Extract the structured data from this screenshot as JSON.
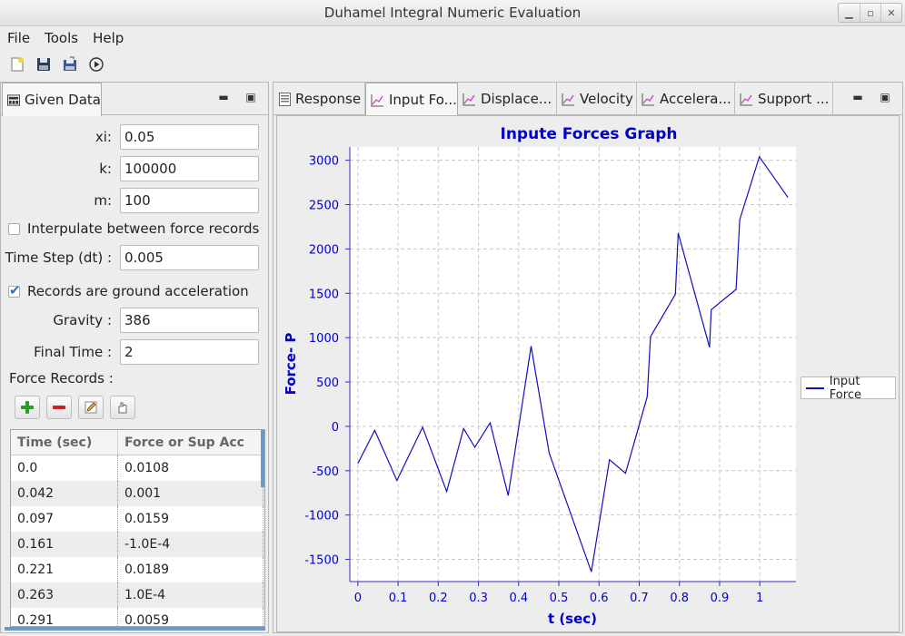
{
  "window": {
    "title": "Duhamel Integral Numeric Evaluation"
  },
  "menu": [
    "File",
    "Tools",
    "Help"
  ],
  "toolbar": [
    "new-file-icon",
    "save-icon",
    "save-as-icon",
    "run-icon"
  ],
  "left_panel": {
    "tab": "Given Data",
    "fields": {
      "xi": {
        "label": "xi:",
        "value": "0.05"
      },
      "k": {
        "label": "k:",
        "value": "100000"
      },
      "m": {
        "label": "m:",
        "value": "100"
      },
      "interpolate": {
        "label": "Interpulate between force records",
        "checked": false
      },
      "dt": {
        "label": "Time Step (dt) :",
        "value": "0.005"
      },
      "ground": {
        "label": "Records are ground acceleration",
        "checked": true
      },
      "gravity": {
        "label": "Gravity :",
        "value": "386"
      },
      "final_time": {
        "label": "Final Time :",
        "value": "2"
      }
    },
    "records_label": "Force Records :",
    "table": {
      "headers": [
        "Time (sec)",
        "Force or Sup Acc"
      ],
      "rows": [
        [
          "0.0",
          "0.0108"
        ],
        [
          "0.042",
          "0.001"
        ],
        [
          "0.097",
          "0.0159"
        ],
        [
          "0.161",
          "-1.0E-4"
        ],
        [
          "0.221",
          "0.0189"
        ],
        [
          "0.263",
          "1.0E-4"
        ],
        [
          "0.291",
          "0.0059"
        ]
      ]
    }
  },
  "right_panel": {
    "tabs": [
      "Response",
      "Input Fo...",
      "Displace...",
      "Velocity",
      "Accelera...",
      "Support ..."
    ],
    "active_tab": 1
  },
  "colors": {
    "series": "#1010c0",
    "title": "#0000cc"
  },
  "chart_data": {
    "type": "line",
    "title": "Inpute Forces Graph",
    "xlabel": "t (sec)",
    "ylabel": "Force- P",
    "xlim": [
      -0.02,
      1.09
    ],
    "ylim": [
      -1750,
      3150
    ],
    "xticks": [
      "0",
      "0.1",
      "0.2",
      "0.3",
      "0.4",
      "0.5",
      "0.6",
      "0.7",
      "0.8",
      "0.9",
      "1"
    ],
    "yticks": [
      "-1500",
      "-1000",
      "-500",
      "0",
      "500",
      "1000",
      "1500",
      "2000",
      "2500",
      "3000"
    ],
    "grid": true,
    "legend_position": "right",
    "series": [
      {
        "name": "Input Force",
        "x": [
          0.0,
          0.042,
          0.097,
          0.161,
          0.221,
          0.263,
          0.291,
          0.329,
          0.374,
          0.431,
          0.476,
          0.581,
          0.626,
          0.666,
          0.72,
          0.728,
          0.79,
          0.797,
          0.875,
          0.879,
          0.941,
          0.95,
          0.999,
          1.07
        ],
        "y": [
          -420,
          -45,
          -610,
          -10,
          -735,
          -25,
          -235,
          40,
          -780,
          905,
          -300,
          -1640,
          -375,
          -530,
          335,
          1010,
          1490,
          2180,
          890,
          1315,
          1545,
          2330,
          3040,
          2580
        ]
      }
    ]
  }
}
